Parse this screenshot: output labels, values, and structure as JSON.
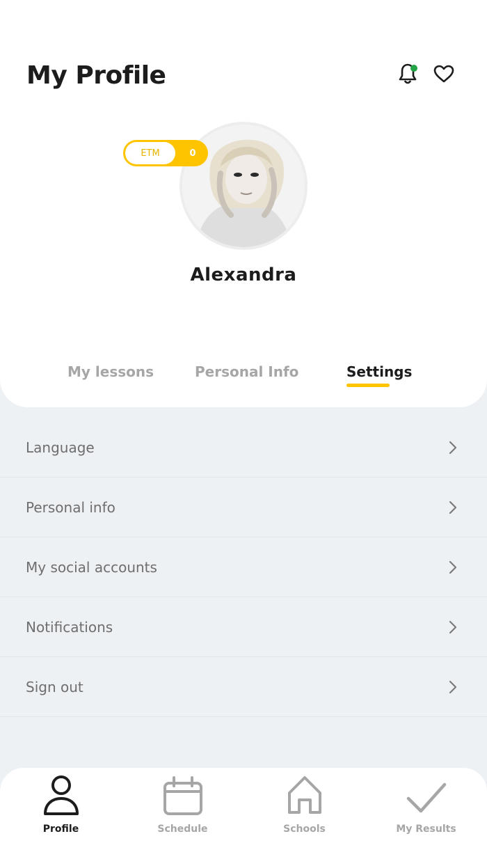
{
  "header": {
    "title": "My Profile",
    "notification_icon": "bell-icon",
    "favorites_icon": "heart-icon",
    "notification_dot_color": "#22a447"
  },
  "profile": {
    "name": "Alexandra",
    "badge_label": "ETM",
    "badge_value": "0",
    "accent_color": "#ffc400"
  },
  "tabs": [
    {
      "label": "My lessons",
      "active": false
    },
    {
      "label": "Personal Info",
      "active": false
    },
    {
      "label": "Settings",
      "active": true
    }
  ],
  "settings": [
    {
      "label": "Language"
    },
    {
      "label": "Personal info"
    },
    {
      "label": "My social accounts"
    },
    {
      "label": "Notifications"
    },
    {
      "label": "Sign out"
    }
  ],
  "bottom_nav": [
    {
      "label": "Profile",
      "icon": "person-icon",
      "active": true
    },
    {
      "label": "Schedule",
      "icon": "calendar-icon",
      "active": false
    },
    {
      "label": "Schools",
      "icon": "home-icon",
      "active": false
    },
    {
      "label": "My Results",
      "icon": "checkmark-icon",
      "active": false
    }
  ]
}
